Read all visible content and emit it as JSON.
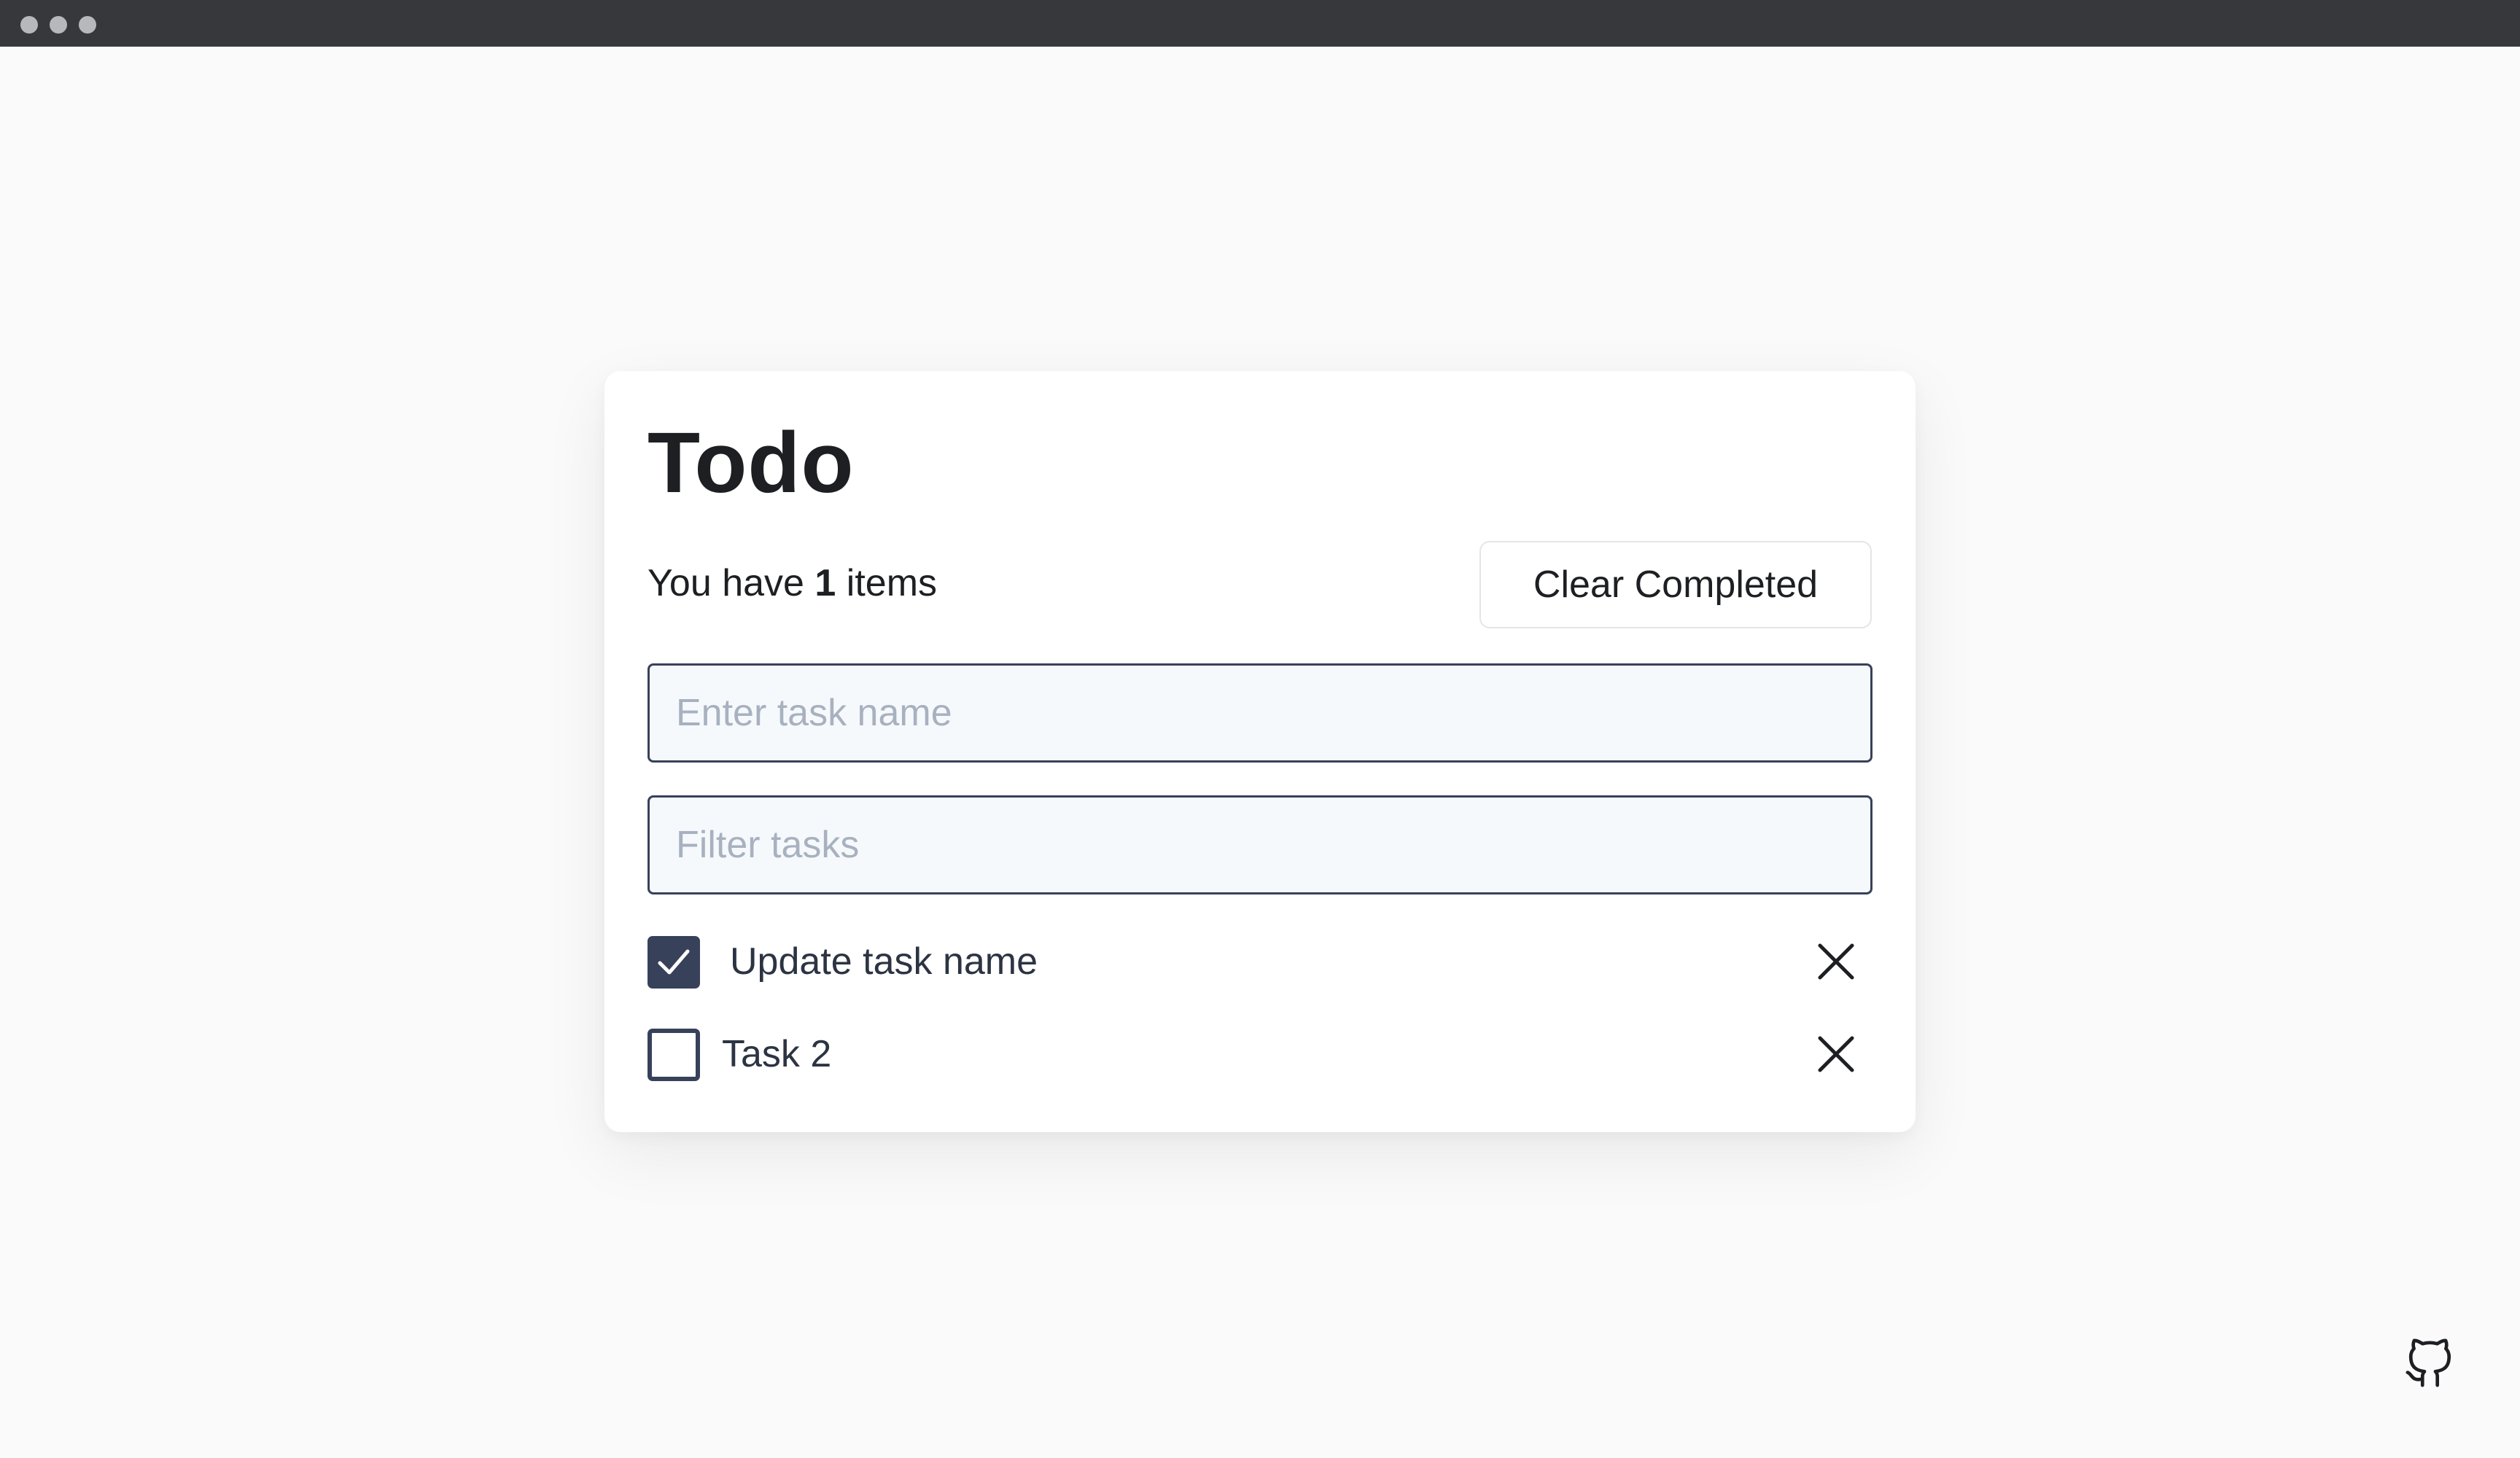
{
  "app": {
    "title": "Todo"
  },
  "summary": {
    "prefix": "You have",
    "count": "1",
    "suffix": "items"
  },
  "toolbar": {
    "clear_label": "Clear Completed"
  },
  "inputs": {
    "task_placeholder": "Enter task name",
    "task_value": "",
    "filter_placeholder": "Filter tasks",
    "filter_value": ""
  },
  "tasks": [
    {
      "label": "Update task name",
      "completed": true
    },
    {
      "label": "Task 2",
      "completed": false
    }
  ],
  "icons": {
    "check": "check-icon",
    "delete": "close-icon",
    "github": "github-icon"
  },
  "colors": {
    "accent": "#37415a",
    "background": "#fafafa",
    "card": "#ffffff",
    "titlebar": "#37383b"
  }
}
